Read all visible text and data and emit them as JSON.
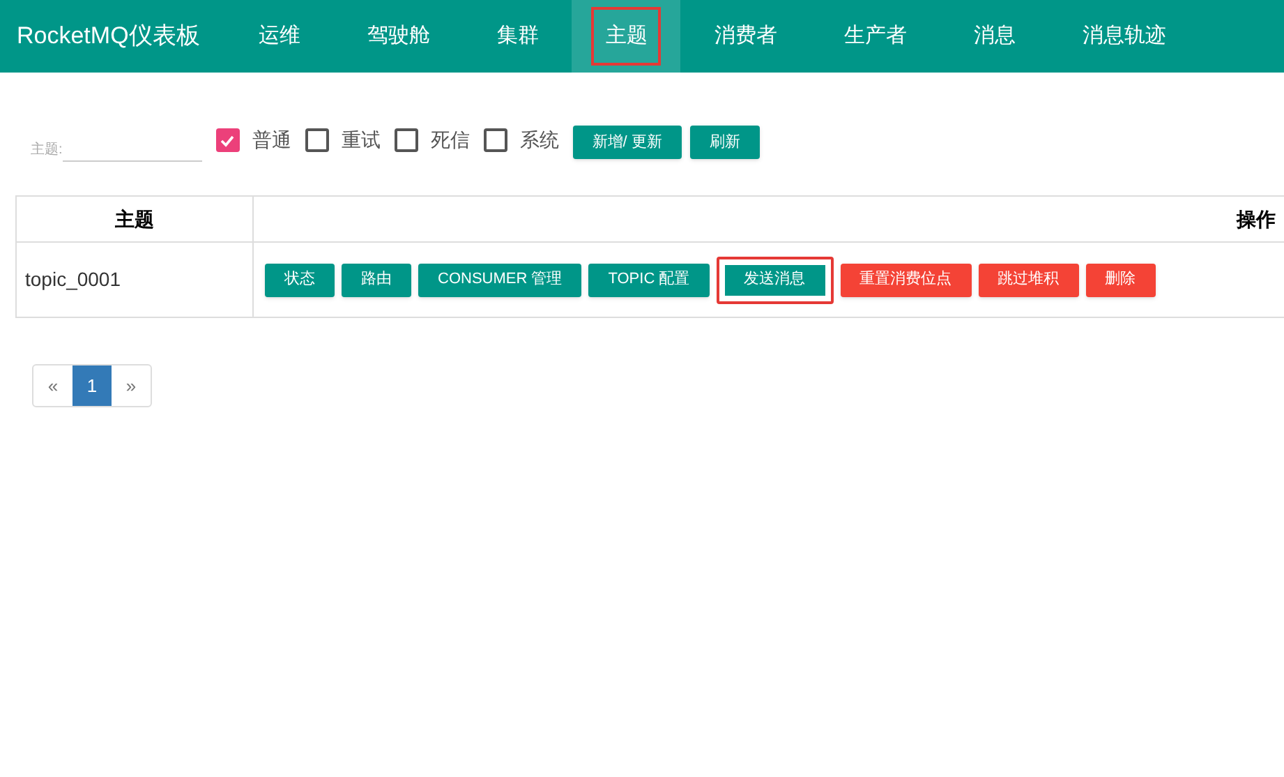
{
  "brand": "RocketMQ仪表板",
  "nav": [
    {
      "label": "运维",
      "selected": false,
      "highlighted": false
    },
    {
      "label": "驾驶舱",
      "selected": false,
      "highlighted": false
    },
    {
      "label": "集群",
      "selected": false,
      "highlighted": false
    },
    {
      "label": "主题",
      "selected": true,
      "highlighted": true
    },
    {
      "label": "消费者",
      "selected": false,
      "highlighted": false
    },
    {
      "label": "生产者",
      "selected": false,
      "highlighted": false
    },
    {
      "label": "消息",
      "selected": false,
      "highlighted": false
    },
    {
      "label": "消息轨迹",
      "selected": false,
      "highlighted": false
    }
  ],
  "filter": {
    "label": "主题:",
    "checkboxes": [
      {
        "label": "普通",
        "checked": true
      },
      {
        "label": "重试",
        "checked": false
      },
      {
        "label": "死信",
        "checked": false
      },
      {
        "label": "系统",
        "checked": false
      }
    ],
    "buttons": [
      "新增/ 更新",
      "刷新"
    ]
  },
  "table": {
    "columns": [
      "主题",
      "操作"
    ],
    "rows": [
      {
        "topic": "topic_0001",
        "actions": [
          {
            "label": "状态",
            "kind": "primary",
            "highlighted": false
          },
          {
            "label": "路由",
            "kind": "primary",
            "highlighted": false
          },
          {
            "label": "CONSUMER 管理",
            "kind": "primary",
            "highlighted": false
          },
          {
            "label": "TOPIC 配置",
            "kind": "primary",
            "highlighted": false
          },
          {
            "label": "发送消息",
            "kind": "primary",
            "highlighted": true
          },
          {
            "label": "重置消费位点",
            "kind": "danger",
            "highlighted": false
          },
          {
            "label": "跳过堆积",
            "kind": "danger",
            "highlighted": false
          },
          {
            "label": "删除",
            "kind": "danger",
            "highlighted": false
          }
        ]
      }
    ]
  },
  "pagination": {
    "prev": "«",
    "pages": [
      {
        "label": "1",
        "selected": true
      }
    ],
    "next": "»"
  }
}
